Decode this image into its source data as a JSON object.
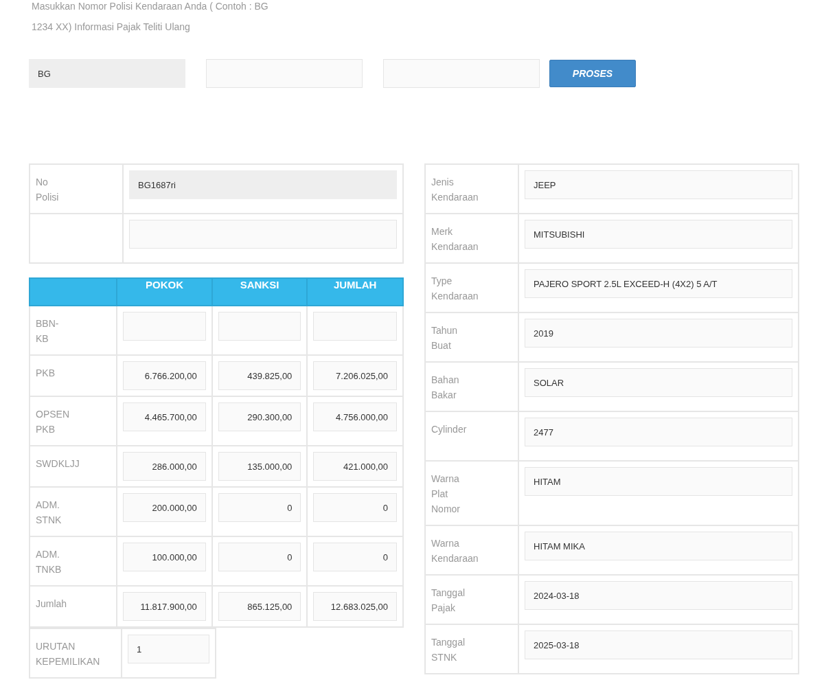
{
  "instruction": "Masukkan Nomor Polisi Kendaraan Anda ( Contoh : BG 1234 XX) Informasi Pajak Teliti Ulang",
  "plate_fields": [
    {
      "value": "BG",
      "readonly": true
    },
    {
      "readonly": false
    },
    {
      "readonly": false
    }
  ],
  "process_button": "PROSES",
  "police_number_table": {
    "rows": [
      {
        "label": "No Polisi",
        "field": {
          "value": "BG1687ri",
          "readonly": true
        }
      },
      {
        "field": {
          "readonly": false
        }
      }
    ]
  },
  "tax_table": {
    "columns": [
      "POKOK",
      "SANKSI",
      "JUMLAH"
    ],
    "rows": [
      {
        "label": "BBN-KB",
        "cells": [
          {},
          {},
          {}
        ]
      },
      {
        "label": "PKB",
        "cells": [
          {
            "value": "6.766.200,00"
          },
          {
            "value": "439.825,00"
          },
          {
            "value": "7.206.025,00"
          }
        ]
      },
      {
        "label": "OPSEN PKB",
        "cells": [
          {
            "value": "4.465.700,00"
          },
          {
            "value": "290.300,00"
          },
          {
            "value": "4.756.000,00"
          }
        ]
      },
      {
        "label": "SWDKLJJ",
        "cells": [
          {
            "value": "286.000,00"
          },
          {
            "value": "135.000,00"
          },
          {
            "value": "421.000,00"
          }
        ]
      },
      {
        "label": "ADM. STNK",
        "cells": [
          {
            "value": "200.000,00"
          },
          {
            "value": "0"
          },
          {
            "value": "0"
          }
        ]
      },
      {
        "label": "ADM. TNKB",
        "cells": [
          {
            "value": "100.000,00"
          },
          {
            "value": "0"
          },
          {
            "value": "0"
          }
        ]
      },
      {
        "label": "Jumlah",
        "cells": [
          {
            "value": "11.817.900,00"
          },
          {
            "value": "865.125,00"
          },
          {
            "value": "12.683.025,00"
          }
        ]
      }
    ],
    "ownership": {
      "label": "URUTAN KEPEMILIKAN",
      "value": "1"
    }
  },
  "vehicle_table": {
    "rows": [
      {
        "label": "Jenis Kendaraan",
        "value": "JEEP"
      },
      {
        "label": "Merk Kendaraan",
        "value": "MITSUBISHI"
      },
      {
        "label": "Type Kendaraan",
        "value": "PAJERO SPORT 2.5L EXCEED-H (4X2) 5 A/T"
      },
      {
        "label": "Tahun Buat",
        "value": "2019"
      },
      {
        "label": "Bahan Bakar",
        "value": "SOLAR"
      },
      {
        "label": "Cylinder",
        "value": "2477"
      },
      {
        "label": "Warna Plat Nomor",
        "value": "HITAM"
      },
      {
        "label": "Warna Kendaraan",
        "value": "HITAM MIKA"
      },
      {
        "label": "Tanggal Pajak",
        "value": "2024-03-18"
      },
      {
        "label": "Tanggal STNK",
        "value": "2025-03-18"
      }
    ]
  }
}
